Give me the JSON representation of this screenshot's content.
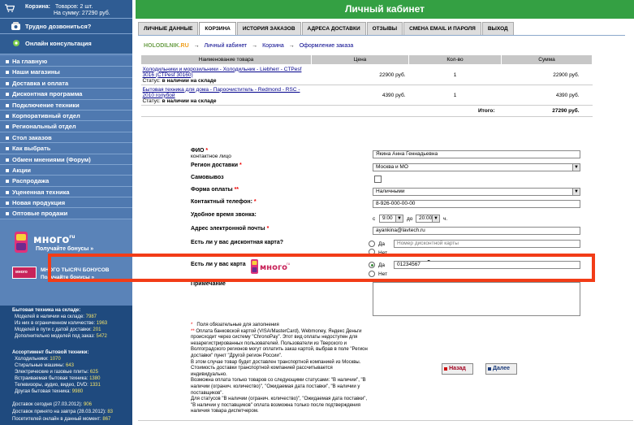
{
  "sidebar": {
    "cart": {
      "title": "Корзина:",
      "goods": "Товаров: 2 шт.",
      "sum": "На сумму: 27290 руб."
    },
    "help": "Трудно дозвониться?",
    "consult": "Онлайн консультация",
    "nav": [
      "На главную",
      "Наши магазины",
      "Доставка и оплата",
      "Дисконтная программа",
      "Подключение техники",
      "Корпоративный отдел",
      "Региональный отдел",
      "Стол заказов",
      "Как выбрать",
      "Обмен мнениями (Форум)",
      "Акции",
      "Распродажа",
      "Уцененная техника",
      "Новая продукция",
      "Оптовые продажи"
    ],
    "mnogo": {
      "word": "много",
      "ru": "ru",
      "bonus_link": "Получайте бонусы »",
      "banner_label": "много",
      "thousand_title": "МНОГО ТЫСЯЧ БОНУСОВ",
      "thousand_link": "Получайте бонусы »"
    },
    "stats": {
      "head1": "Бытовая техника на складе:",
      "lines1": [
        {
          "label": "Моделей в наличии на складе:",
          "value": "7987"
        },
        {
          "label": "Из них в ограниченном количестве:",
          "value": "1963"
        },
        {
          "label": "Моделей в пути с датой доставки:",
          "value": "201"
        },
        {
          "label": "Дополнительно моделей под заказ:",
          "value": "5472"
        }
      ],
      "head2": "Ассортимент бытовой техники:",
      "lines2": [
        {
          "label": "Холодильники:",
          "value": "1070"
        },
        {
          "label": "Стиральные машины:",
          "value": "643"
        },
        {
          "label": "Электрические и газовые плиты:",
          "value": "625"
        },
        {
          "label": "Встраиваемая бытовая техника:",
          "value": "1380"
        },
        {
          "label": "Телевизоры, аудио, видео, DVD:",
          "value": "1331"
        },
        {
          "label": "Другая бытовая техника:",
          "value": "9980"
        }
      ],
      "footer": [
        {
          "label": "Доставок сегодня (27.03.2012):",
          "value": "906"
        },
        {
          "label": "Доставок принято на завтра (28.03.2012):",
          "value": "83"
        },
        {
          "label": "Посетителей онлайн в данный момент:",
          "value": "867"
        }
      ]
    }
  },
  "header": {
    "title": "Личный кабинет"
  },
  "tabs": [
    "ЛИЧНЫЕ ДАННЫЕ",
    "КОРЗИНА",
    "ИСТОРИЯ ЗАКАЗОВ",
    "АДРЕСА ДОСТАВКИ",
    "ОТЗЫВЫ",
    "СМЕНА EMAIL И ПАРОЛЯ",
    "ВЫХОД"
  ],
  "active_tab": "КОРЗИНА",
  "breadcrumb": {
    "home_a": "HOLODILNIK",
    "home_b": ".RU",
    "items": [
      "Личный кабинет",
      "Корзина",
      "Оформление заказа"
    ]
  },
  "cart_table": {
    "headers": [
      "Наименование товара",
      "Цена",
      "Кол-во",
      "Сумма"
    ],
    "rows": [
      {
        "name": "Холодильники и морозильники - Холодильник - Liebherr - CTPesf 3016 (CTPesf 30160)",
        "status_label": "Статус:",
        "status": "в наличии на складе",
        "price": "22900 руб.",
        "qty": "1",
        "sum": "22900 руб."
      },
      {
        "name": "Бытовая техника для дома - Пароочиститель - Redmond - RSC - 2010 голубой",
        "status_label": "Статус:",
        "status": "в наличии на складе",
        "price": "4390 руб.",
        "qty": "1",
        "sum": "4390 руб."
      }
    ],
    "total_label": "Итого:",
    "total": "27290 руб."
  },
  "form": {
    "fio_label": "ФИО",
    "fio_sub": "контактное лицо",
    "fio_value": "Якина Анна Геннадьевна",
    "region_label": "Регион доставки",
    "region_value": "Москва и МО",
    "pickup_label": "Самовывоз",
    "payment_label": "Форма оплаты",
    "payment_value": "Наличными",
    "phone_label": "Контактный телефон:",
    "phone_value": "8-926-000-00-00",
    "time_label": "Удобное время звонка:",
    "time_from_prefix": "с",
    "time_from": "9:00",
    "time_to_prefix": "до",
    "time_to": "20:00",
    "time_suffix": "ч.",
    "email_label": "Адрес электронной почты",
    "email_value": "ayankina@lavtech.ru",
    "discount_label": "Есть ли у вас дисконтная карта?",
    "discount_yes": "Да",
    "discount_no": "Нет",
    "discount_placeholder": "Номер дисконтной карты",
    "mnogo_label": "Есть ли у вас карта",
    "mnogo_q": "?",
    "mnogo_yes": "Да",
    "mnogo_no": "Нет",
    "mnogo_value": "01234567",
    "comment_label": "Примечание"
  },
  "notes": {
    "req1_mark": "*",
    "req1": "Поля обязательные для заполнения",
    "req2_mark": "**",
    "req2": "Оплата банковской картой (VISA/MasterCard), Webmoney, Яндекс Деньги происходит через систему \"ChronoPay\". Этот вид оплаты недоступен для незарегистрированных пользователей. Пользователи из Тверского и Волгоградского регионов могут оплатить заказ картой, выбрав в поле \"Регион доставки\" пункт \"Другой регион России\".",
    "p2": "В этом случае товар будет доставлен транспортной компанией из Москвы. Стоимость доставки транспортной компанией рассчитывается индивидуально.",
    "p3": "Возможна оплата только товаров со следующими статусами: \"В наличии\", \"В наличии (огранич. количество)\", \"Ожидаемая дата поставки\", \"В наличии у поставщиков\".",
    "p4": "Для статусов \"В наличии (огранич. количество)\", \"Ожидаемая дата поставки\", \"В наличии у поставщиков\" оплата возможна только после подтверждения наличия товара диспетчером."
  },
  "buttons": {
    "back": "Назад",
    "next": "Далее"
  },
  "colors": {
    "accent_green": "#34a043",
    "sidebar": "#5a83b8",
    "highlight": "#f23c17"
  }
}
